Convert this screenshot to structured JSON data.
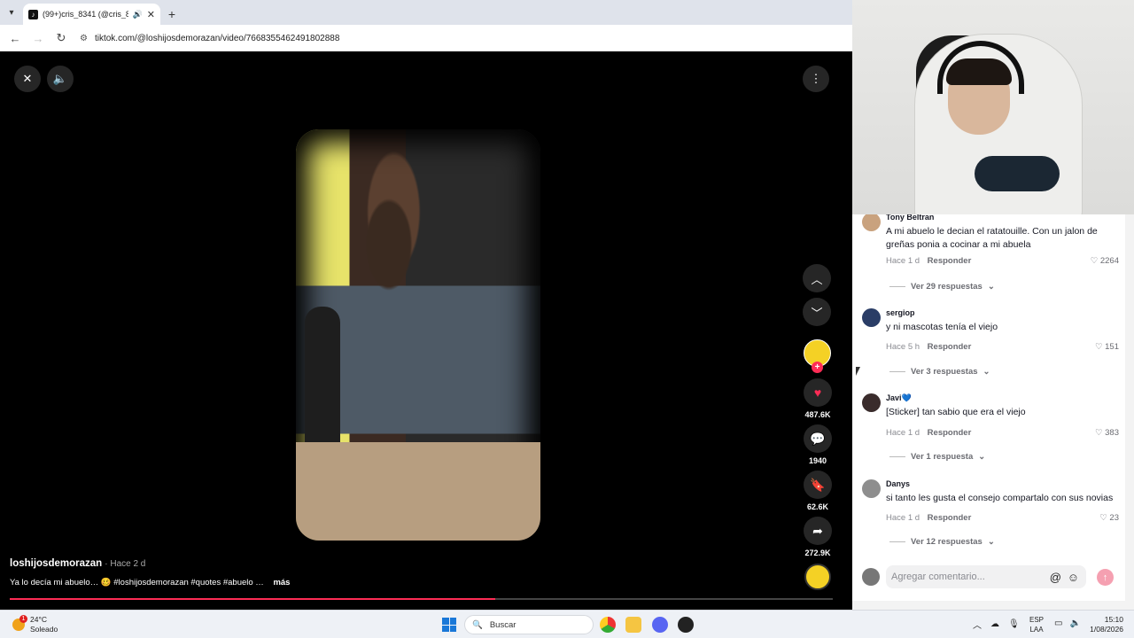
{
  "browser": {
    "tab_title": "(99+)cris_8341 (@cris_834…",
    "url": "tiktok.com/@loshijosdemorazan/video/7668355462491802888"
  },
  "video": {
    "author": "loshijosdemorazan",
    "time": "· Hace 2 d",
    "caption": "Ya lo decía mi abuelo… 🥴 #loshijosdemorazan #quotes #abuelo …",
    "more": "más",
    "progress": 0.59,
    "likes": "487.6K",
    "comments": "1940",
    "saves": "62.6K",
    "shares": "272.9K"
  },
  "comments": [
    {
      "user": "Tony Beltran",
      "text": "A mi abuelo le decian el ratatouille. Con un jalon de greñas ponia a cocinar a mi abuela",
      "time": "Hace 1 d",
      "reply": "Responder",
      "likes": "2264",
      "view_replies": "Ver 29 respuestas",
      "avatar_color": "#c9a27e"
    },
    {
      "user": "sergiop",
      "text": "y ni mascotas tenía el viejo",
      "time": "Hace 5 h",
      "reply": "Responder",
      "likes": "151",
      "view_replies": "Ver 3 respuestas",
      "avatar_color": "#2a3d66"
    },
    {
      "user": "Javi💙",
      "text": "[Sticker] tan sabio que era el viejo",
      "time": "Hace 1 d",
      "reply": "Responder",
      "likes": "383",
      "view_replies": "Ver 1 respuesta",
      "avatar_color": "#3a2c2c"
    },
    {
      "user": "Danys",
      "text": "si tanto les gusta el consejo compartalo con sus novias",
      "time": "Hace 1 d",
      "reply": "Responder",
      "likes": "23",
      "view_replies": "Ver 12 respuestas",
      "avatar_color": "#8e8e8e"
    }
  ],
  "comment_input": {
    "placeholder": "Agregar comentario..."
  },
  "taskbar": {
    "temp": "24°C",
    "weather": "Soleado",
    "weather_badge": "1",
    "search": "Buscar",
    "lang1": "ESP",
    "lang2": "LAA",
    "time": "15:10",
    "date": "1/08/2026"
  }
}
